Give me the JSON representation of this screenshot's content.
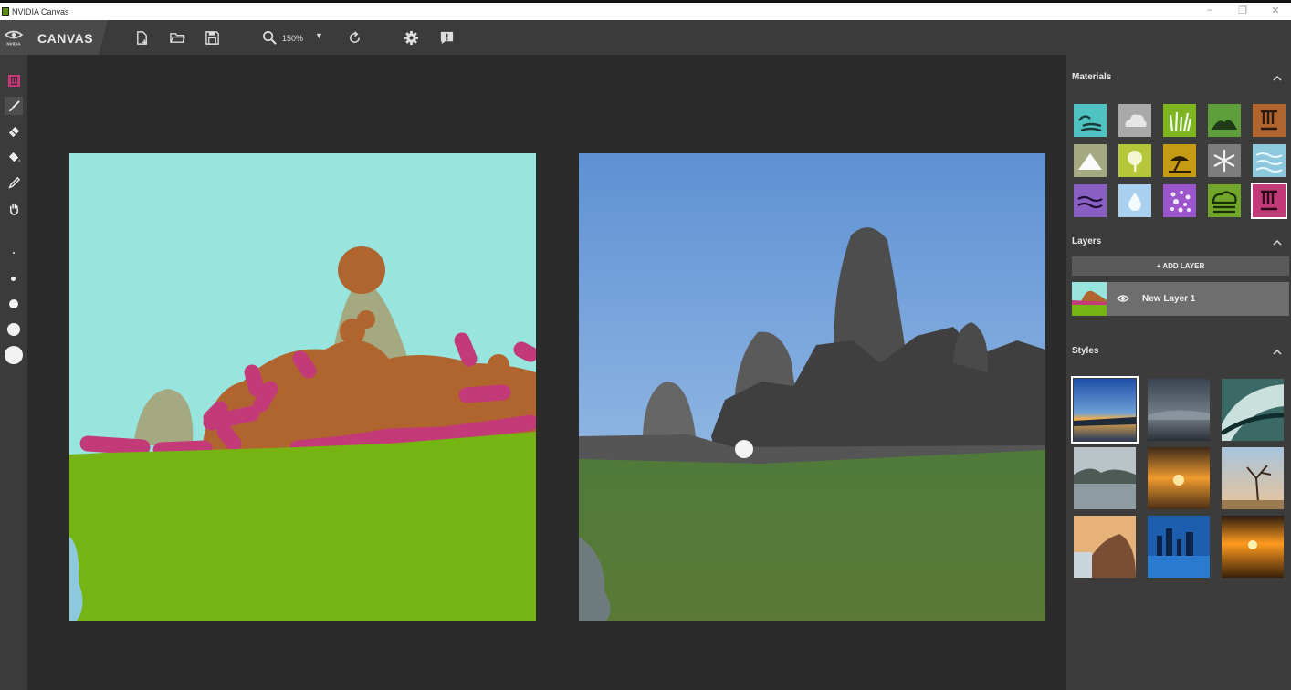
{
  "window": {
    "title": "NVIDIA Canvas",
    "controls": [
      "–",
      "❐",
      "✕"
    ]
  },
  "brand": {
    "logo_text": "NVIDIA",
    "name": "CANVAS"
  },
  "toolbar": {
    "zoom_level": "150%",
    "buttons": [
      "new-file-icon",
      "open-folder-icon",
      "save-icon",
      "zoom-icon",
      "zoom-dropdown-icon",
      "refresh-icon",
      "settings-icon",
      "feedback-icon"
    ]
  },
  "tools": [
    "material-icon",
    "brush-icon",
    "eraser-icon",
    "fill-icon",
    "eyedropper-icon",
    "pan-icon"
  ],
  "brush_sizes": [
    "tiny",
    "small",
    "medium",
    "large",
    "xlarge"
  ],
  "panel": {
    "materials": {
      "title": "Materials",
      "items": [
        {
          "name": "sea",
          "color": "#4fc3c1"
        },
        {
          "name": "cloud",
          "color": "#a9a9a9"
        },
        {
          "name": "grass",
          "color": "#7fb521"
        },
        {
          "name": "hill",
          "color": "#5e9e3b"
        },
        {
          "name": "rock",
          "color": "#b0652f"
        },
        {
          "name": "mountain",
          "color": "#a5a981"
        },
        {
          "name": "tree",
          "color": "#b5c739"
        },
        {
          "name": "sand",
          "color": "#c49b12"
        },
        {
          "name": "snow",
          "color": "#7d7d7d"
        },
        {
          "name": "water",
          "color": "#8ec8dd"
        },
        {
          "name": "river",
          "color": "#8a5fc4"
        },
        {
          "name": "fog",
          "color": "#aad0f0"
        },
        {
          "name": "flower",
          "color": "#9d55cc"
        },
        {
          "name": "bush",
          "color": "#72a62a"
        },
        {
          "name": "stone",
          "color": "#c33a78"
        }
      ],
      "selected": "stone"
    },
    "layers": {
      "title": "Layers",
      "add_label": "+ ADD LAYER",
      "items": [
        {
          "name": "New Layer 1",
          "visible": true
        }
      ]
    },
    "styles": {
      "title": "Styles",
      "count": 9,
      "selected_index": 0
    }
  },
  "colors": {
    "sky": "#98e5e0",
    "grass": "#76b413",
    "rock": "#b0652f",
    "stone": "#c33a78",
    "mountain": "#a5a981"
  }
}
